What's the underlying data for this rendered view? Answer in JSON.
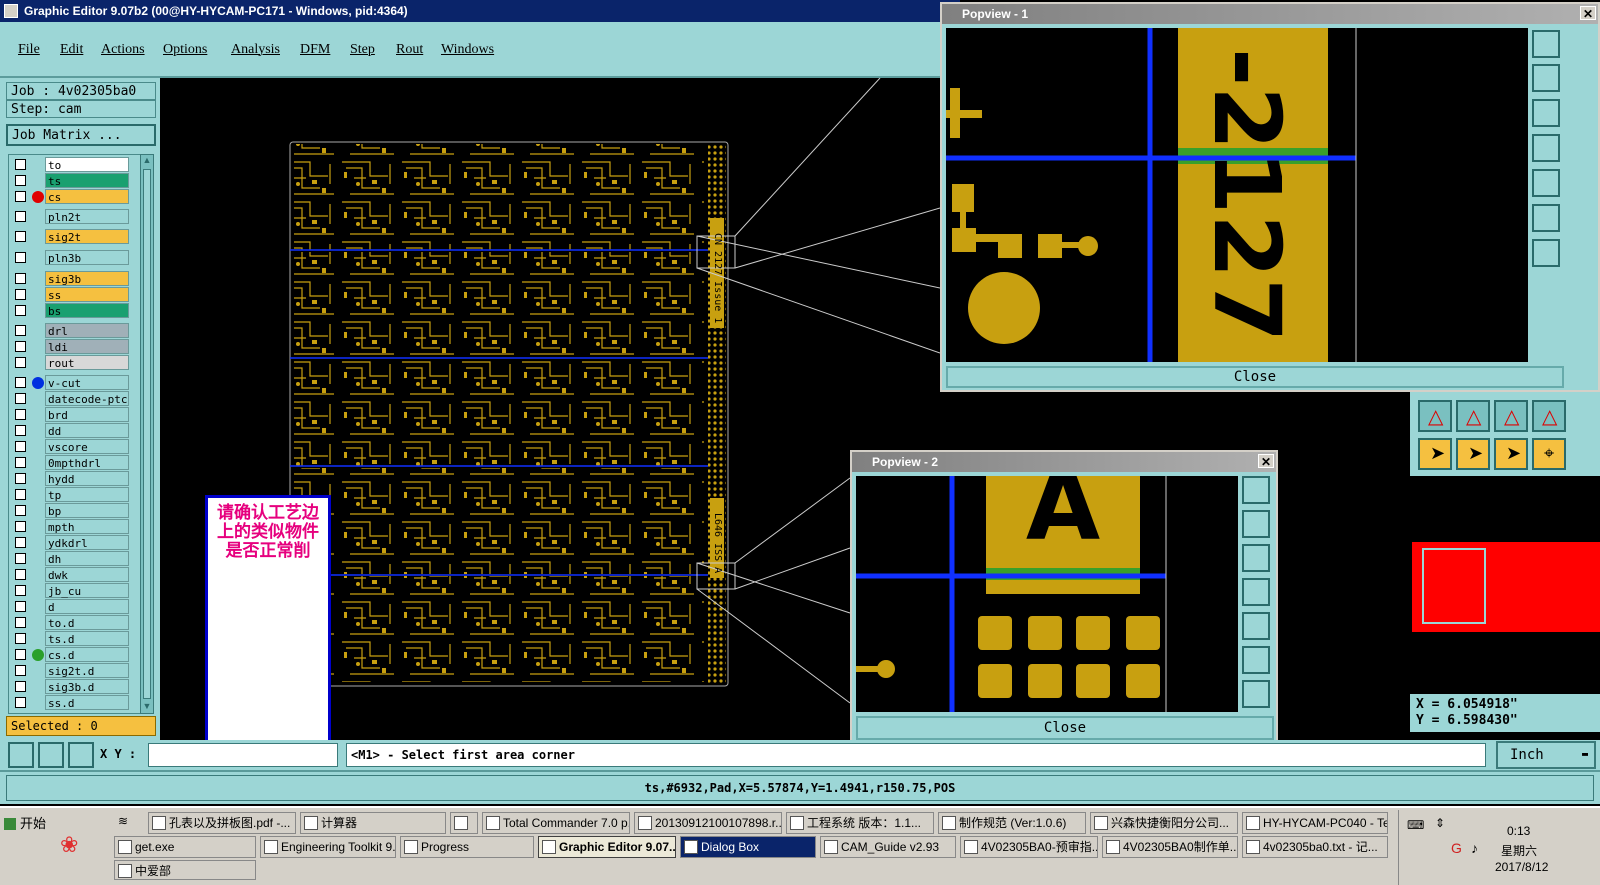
{
  "window": {
    "title": "Graphic Editor 9.07b2 (00@HY-HYCAM-PC171 - Windows, pid:4364)"
  },
  "menu": [
    "File",
    "Edit",
    "Actions",
    "Options",
    "Analysis",
    "DFM",
    "Step",
    "Rout",
    "Windows"
  ],
  "job": {
    "job_label": "Job : 4v02305ba0",
    "step_label": "Step: cam",
    "matrix_button": "Job Matrix ..."
  },
  "layers": [
    {
      "name": "to",
      "color": "#ffffff"
    },
    {
      "name": "ts",
      "color": "#1aa070"
    },
    {
      "name": "cs",
      "color": "#f5c040",
      "dot": "#e00000"
    },
    {
      "name": "pln2t",
      "color": "#9cd6d6"
    },
    {
      "name": "sig2t",
      "color": "#f5c040"
    },
    {
      "name": "pln3b",
      "color": "#9cd6d6"
    },
    {
      "name": "sig3b",
      "color": "#f5c040"
    },
    {
      "name": "ss",
      "color": "#f5c040"
    },
    {
      "name": "bs",
      "color": "#1aa070"
    },
    {
      "name": "drl",
      "color": "#a0b0b8"
    },
    {
      "name": "ldi",
      "color": "#a0b0b8"
    },
    {
      "name": "rout",
      "color": "#d8d8d8"
    },
    {
      "name": "v-cut",
      "color": "#9cd6d6",
      "dot": "#0030e0"
    },
    {
      "name": "datecode-ptc",
      "color": "#9cd6d6"
    },
    {
      "name": "brd",
      "color": "#9cd6d6"
    },
    {
      "name": "dd",
      "color": "#9cd6d6"
    },
    {
      "name": "vscore",
      "color": "#9cd6d6"
    },
    {
      "name": "0mpthdrl",
      "color": "#9cd6d6"
    },
    {
      "name": "hydd",
      "color": "#9cd6d6"
    },
    {
      "name": "tp",
      "color": "#9cd6d6"
    },
    {
      "name": "bp",
      "color": "#9cd6d6"
    },
    {
      "name": "mpth",
      "color": "#9cd6d6"
    },
    {
      "name": "ydkdrl",
      "color": "#9cd6d6"
    },
    {
      "name": "dh",
      "color": "#9cd6d6"
    },
    {
      "name": "dwk",
      "color": "#9cd6d6"
    },
    {
      "name": "jb_cu",
      "color": "#9cd6d6"
    },
    {
      "name": "d",
      "color": "#9cd6d6"
    },
    {
      "name": "to.d",
      "color": "#9cd6d6"
    },
    {
      "name": "ts.d",
      "color": "#9cd6d6"
    },
    {
      "name": "cs.d",
      "color": "#9cd6d6",
      "dot": "#2aa02a"
    },
    {
      "name": "sig2t.d",
      "color": "#9cd6d6"
    },
    {
      "name": "sig3b.d",
      "color": "#9cd6d6"
    },
    {
      "name": "ss.d",
      "color": "#9cd6d6"
    }
  ],
  "selected": "Selected : 0",
  "note": "请确认工艺边上的类似物件是否正常削",
  "popview1": {
    "title": "Popview - 1",
    "close": "Close",
    "text": "-2127"
  },
  "popview2": {
    "title": "Popview - 2",
    "close": "Close",
    "text": "A"
  },
  "pcb": {
    "side_text_top": "CN 2127 Issue 1",
    "side_text_bottom": "L646 ISS A"
  },
  "coords": {
    "x": "X = 6.054918\"",
    "y": "Y = 6.598430\""
  },
  "cmd": {
    "xy_label": "X Y :",
    "prompt": "<M1> - Select first area corner",
    "units": "Inch"
  },
  "status": "ts,#6932,Pad,X=5.57874,Y=1.4941,r150.75,POS",
  "taskbar": {
    "start": "开始",
    "row1": [
      "孔表以及拼板图.pdf -...",
      "计算器",
      "",
      "Total Commander 7.0 p...",
      "20130912100107898.r...",
      "工程系统  版本：1.1...",
      "制作规范 (Ver:1.0.6)",
      "兴森快捷衡阳分公司...",
      "HY-HYCAM-PC040 - Te..."
    ],
    "row2": [
      "get.exe",
      "Engineering Toolkit 9....",
      "Progress",
      "Graphic Editor 9.07...",
      "Dialog Box",
      "CAM_Guide v2.93",
      "4V02305BA0-预审指...",
      "4V02305BA0制作单...",
      "4v02305ba0.txt - 记..."
    ],
    "row3": [
      "中爱部"
    ],
    "clock": "0:13",
    "weekday": "星期六",
    "date": "2017/8/12"
  }
}
